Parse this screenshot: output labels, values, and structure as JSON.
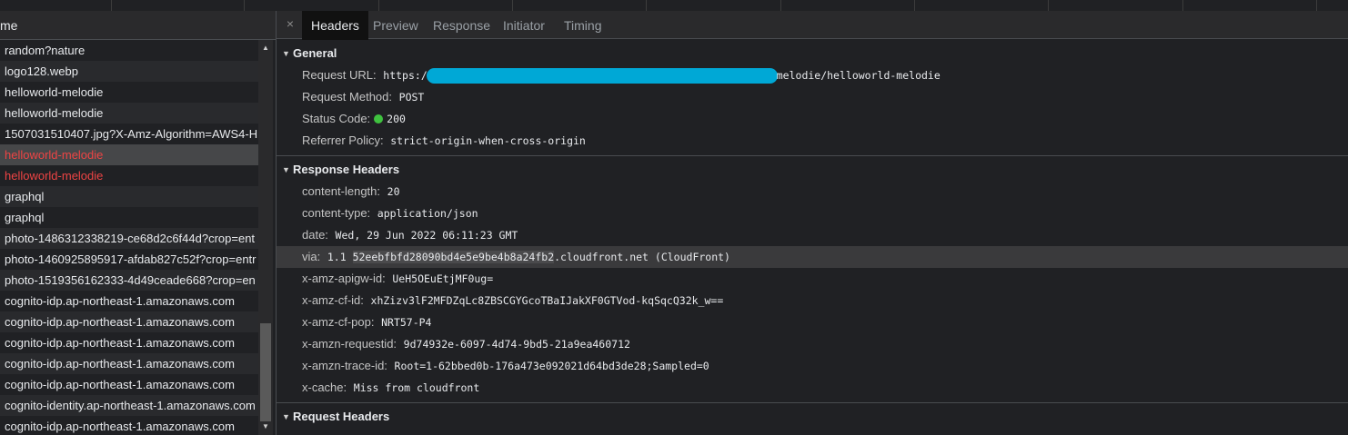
{
  "list": {
    "header": "me",
    "rows": [
      {
        "name": "random?nature",
        "error": false,
        "selected": false
      },
      {
        "name": "logo128.webp",
        "error": false,
        "selected": false
      },
      {
        "name": "helloworld-melodie",
        "error": false,
        "selected": false
      },
      {
        "name": "helloworld-melodie",
        "error": false,
        "selected": false
      },
      {
        "name": "1507031510407.jpg?X-Amz-Algorithm=AWS4-H",
        "error": false,
        "selected": false
      },
      {
        "name": "helloworld-melodie",
        "error": true,
        "selected": true
      },
      {
        "name": "helloworld-melodie",
        "error": true,
        "selected": false
      },
      {
        "name": "graphql",
        "error": false,
        "selected": false
      },
      {
        "name": "graphql",
        "error": false,
        "selected": false
      },
      {
        "name": "photo-1486312338219-ce68d2c6f44d?crop=ent",
        "error": false,
        "selected": false
      },
      {
        "name": "photo-1460925895917-afdab827c52f?crop=entr",
        "error": false,
        "selected": false
      },
      {
        "name": "photo-1519356162333-4d49ceade668?crop=en",
        "error": false,
        "selected": false
      },
      {
        "name": "cognito-idp.ap-northeast-1.amazonaws.com",
        "error": false,
        "selected": false
      },
      {
        "name": "cognito-idp.ap-northeast-1.amazonaws.com",
        "error": false,
        "selected": false
      },
      {
        "name": "cognito-idp.ap-northeast-1.amazonaws.com",
        "error": false,
        "selected": false
      },
      {
        "name": "cognito-idp.ap-northeast-1.amazonaws.com",
        "error": false,
        "selected": false
      },
      {
        "name": "cognito-idp.ap-northeast-1.amazonaws.com",
        "error": false,
        "selected": false
      },
      {
        "name": "cognito-identity.ap-northeast-1.amazonaws.com",
        "error": false,
        "selected": false
      },
      {
        "name": "cognito-idp.ap-northeast-1.amazonaws.com",
        "error": false,
        "selected": false
      }
    ]
  },
  "tabs": {
    "close": "×",
    "headers": "Headers",
    "preview": "Preview",
    "response": "Response",
    "initiator": "Initiator",
    "timing": "Timing"
  },
  "general": {
    "title": "General",
    "request_url_key": "Request URL:",
    "request_url_prefix": "https:/",
    "request_url_suffix": "melodie/helloworld-melodie",
    "request_method_key": "Request Method:",
    "request_method_value": "POST",
    "status_code_key": "Status Code:",
    "status_code_value": "200",
    "referrer_policy_key": "Referrer Policy:",
    "referrer_policy_value": "strict-origin-when-cross-origin"
  },
  "response_headers": {
    "title": "Response Headers",
    "content_length_key": "content-length:",
    "content_length_value": "20",
    "content_type_key": "content-type:",
    "content_type_value": "application/json",
    "date_key": "date:",
    "date_value": "Wed, 29 Jun 2022 06:11:23 GMT",
    "via_key": "via:",
    "via_value_prefix": "1.1 ",
    "via_value_highlight": "52eebfbfd28090bd4e5e9be4b8a24fb2",
    "via_value_suffix": ".cloudfront.net (CloudFront)",
    "apigw_key": "x-amz-apigw-id:",
    "apigw_value": "UeH5OEuEtjMF0ug=",
    "cf_id_key": "x-amz-cf-id:",
    "cf_id_value": "xhZizv3lF2MFDZqLc8ZBSCGYGcoTBaIJakXF0GTVod-kqSqcQ32k_w==",
    "cf_pop_key": "x-amz-cf-pop:",
    "cf_pop_value": "NRT57-P4",
    "requestid_key": "x-amzn-requestid:",
    "requestid_value": "9d74932e-6097-4d74-9bd5-21a9ea460712",
    "trace_key": "x-amzn-trace-id:",
    "trace_value": "Root=1-62bbed0b-176a473e092021d64bd3de28;Sampled=0",
    "cache_key": "x-cache:",
    "cache_value": "Miss from cloudfront"
  },
  "request_headers": {
    "title": "Request Headers"
  },
  "colors": {
    "background": "#202124",
    "error_text": "#ee4444",
    "redaction": "#00a8d6",
    "status_ok": "#3fc23f"
  }
}
